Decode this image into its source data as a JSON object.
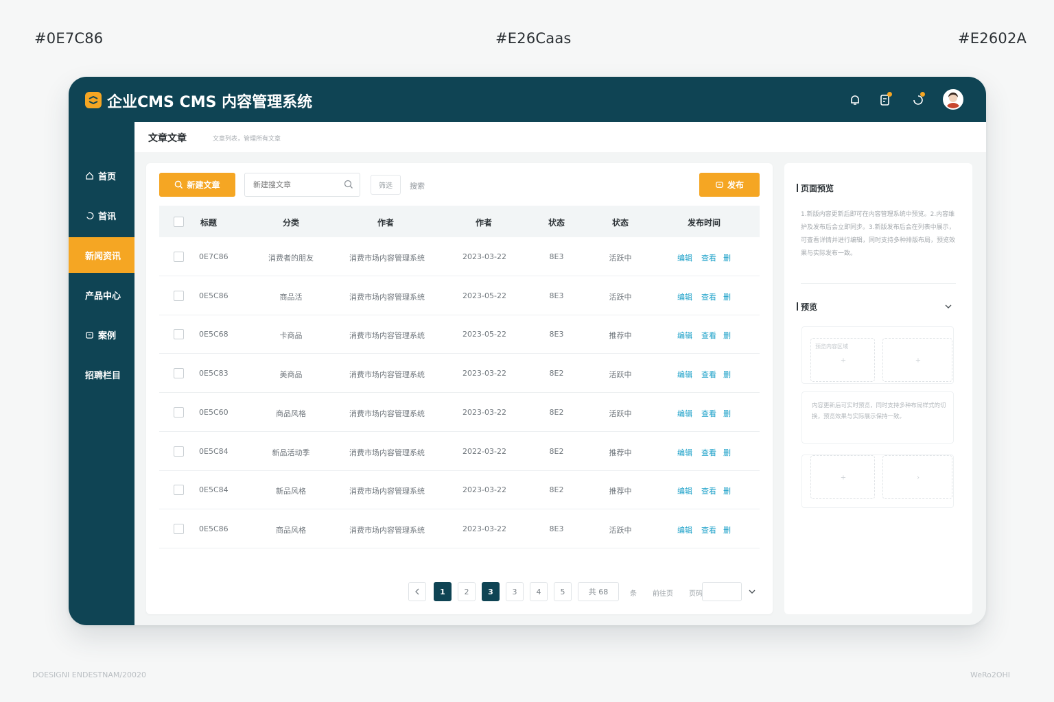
{
  "swatches": {
    "left": "#0E7C86",
    "center": "#E26Caas",
    "right": "#E2602A"
  },
  "footer": {
    "left": "DOESIGNI ENDESTNAM/20020",
    "right": "WeRo2OHI"
  },
  "colors": {
    "primary": "#0F4454",
    "accent": "#F5A623",
    "link": "#1AA0C8"
  },
  "header": {
    "title": "企业CMS CMS 内容管理系统",
    "icons": [
      "bell-icon",
      "document-edit-icon",
      "notification-icon",
      "avatar"
    ]
  },
  "sidebar": {
    "items": [
      {
        "label": "首页",
        "icon": "home-icon"
      },
      {
        "label": "首讯",
        "icon": "refresh-icon"
      },
      {
        "label": "新闻资讯",
        "icon": "",
        "active": true
      },
      {
        "label": "产品中心",
        "icon": ""
      },
      {
        "label": "案例",
        "icon": "case-icon"
      },
      {
        "label": "招聘栏目",
        "icon": ""
      }
    ]
  },
  "breadcrumb": {
    "title": "文章文章",
    "subtitle": "文章列表，管理所有文章"
  },
  "toolbar": {
    "new_label": "新建文章",
    "search_placeholder": "新建搜文章",
    "filter_label": "筛选",
    "search_label": "搜索",
    "publish_label": "发布"
  },
  "table": {
    "headers": [
      "标题",
      "分类",
      "作者",
      "作者",
      "状态",
      "状态",
      "发布时间"
    ],
    "rows": [
      {
        "id": "0E7C86",
        "category": "消费者的朋友",
        "author": "消费市场内容管理系统",
        "date": "2023-03-22",
        "code": "8E3",
        "status": "活跃中",
        "actions": [
          "编辑",
          "查看",
          "删"
        ]
      },
      {
        "id": "0E5C86",
        "category": "商品活",
        "author": "消费市场内容管理系统",
        "date": "2023-05-22",
        "code": "8E3",
        "status": "活跃中",
        "actions": [
          "编辑",
          "查看",
          "删"
        ]
      },
      {
        "id": "0E5C68",
        "category": "卡商品",
        "author": "消费市场内容管理系统",
        "date": "2023-05-22",
        "code": "8E3",
        "status": "推荐中",
        "actions": [
          "编辑",
          "查看",
          "删"
        ]
      },
      {
        "id": "0E5C83",
        "category": "美商品",
        "author": "消费市场内容管理系统",
        "date": "2023-03-22",
        "code": "8E2",
        "status": "活跃中",
        "actions": [
          "编辑",
          "查看",
          "删"
        ]
      },
      {
        "id": "0E5C60",
        "category": "商品风格",
        "author": "消费市场内容管理系统",
        "date": "2023-03-22",
        "code": "8E2",
        "status": "活跃中",
        "actions": [
          "编辑",
          "查看",
          "删"
        ]
      },
      {
        "id": "0E5C84",
        "category": "新品活动季",
        "author": "消费市场内容管理系统",
        "date": "2022-03-22",
        "code": "8E2",
        "status": "推荐中",
        "actions": [
          "编辑",
          "查看",
          "删"
        ]
      },
      {
        "id": "0E5C84",
        "category": "新品风格",
        "author": "消费市场内容管理系统",
        "date": "2023-03-22",
        "code": "8E2",
        "status": "推荐中",
        "actions": [
          "编辑",
          "查看",
          "删"
        ]
      },
      {
        "id": "0E5C86",
        "category": "商品风格",
        "author": "消费市场内容管理系统",
        "date": "2023-03-22",
        "code": "8E3",
        "status": "活跃中",
        "actions": [
          "编辑",
          "查看",
          "删"
        ]
      }
    ]
  },
  "pagination": {
    "pages": [
      "1",
      "2",
      "3",
      "3",
      "4",
      "5"
    ],
    "current": "1",
    "highlight": "3",
    "total_label": "共 68",
    "per_page_label": "条",
    "jump_label": "前往页",
    "goto_label": "页码"
  },
  "preview": {
    "title": "页面预览",
    "text": "1.新版内容更新后即可在内容管理系统中预览。2.内容维护及发布后会立即同步。3.新版发布后会在列表中展示，可查看详情并进行编辑，同时支持多种排版布局，预览效果与实际发布一致。",
    "section_title": "预览",
    "box_label": "预览内容区域",
    "panel_text": "内容更新后可实时预览，同时支持多种布局样式的切换，预览效果与实际展示保持一致。"
  }
}
